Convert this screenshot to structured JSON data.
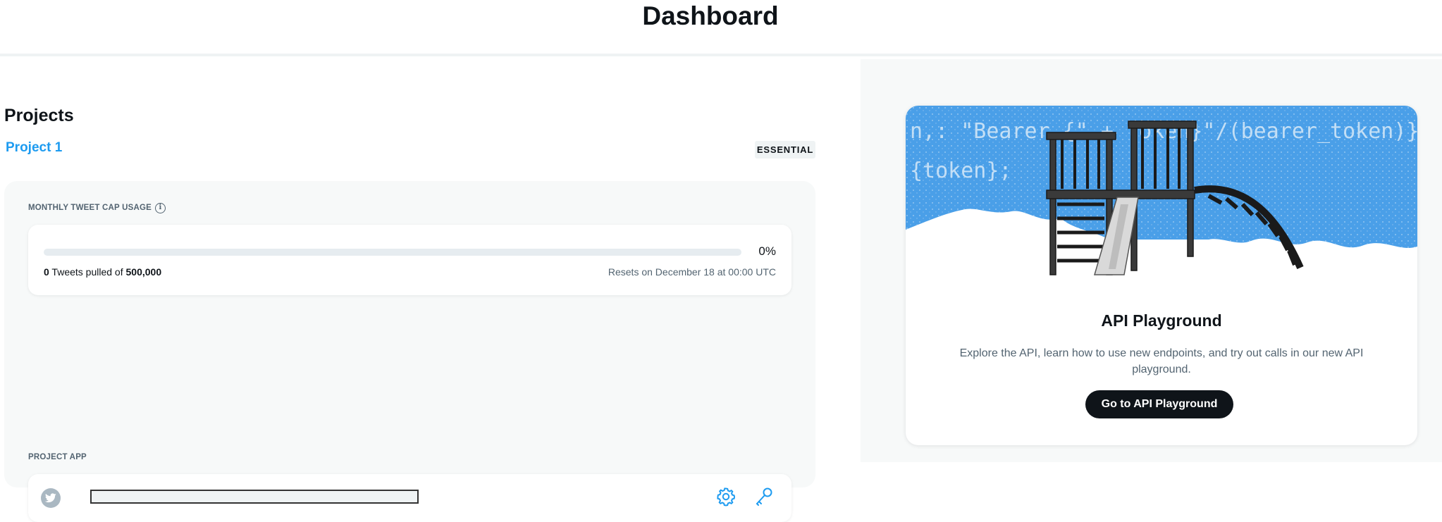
{
  "page": {
    "title": "Dashboard"
  },
  "projects": {
    "heading": "Projects",
    "project": {
      "name": "Project 1",
      "plan_badge": "ESSENTIAL",
      "usage": {
        "label": "MONTHLY TWEET CAP USAGE",
        "percent_text": "0%",
        "percent_value": 0,
        "pulled_count": "0",
        "pulled_text": " Tweets pulled of ",
        "cap": "500,000",
        "reset_text": "Resets on December 18 at 00:00 UTC"
      },
      "app": {
        "label": "PROJECT APP",
        "name": ""
      }
    }
  },
  "playground": {
    "title": "API Playground",
    "description": "Explore the API, learn how to use new endpoints, and try out calls in our new API playground.",
    "button_label": "Go to API Playground",
    "hero_code_line1": "n,: \"Bearer {\" + token}\"/(bearer_token)}",
    "hero_code_line2": "{token};"
  },
  "icons": {
    "info": "info-icon",
    "twitter": "twitter-bird-icon",
    "settings": "gear-icon",
    "keys": "key-icon"
  },
  "colors": {
    "accent": "#1d9bf0",
    "hero_blue": "#4a9fe8",
    "button_dark": "#0f1419"
  }
}
